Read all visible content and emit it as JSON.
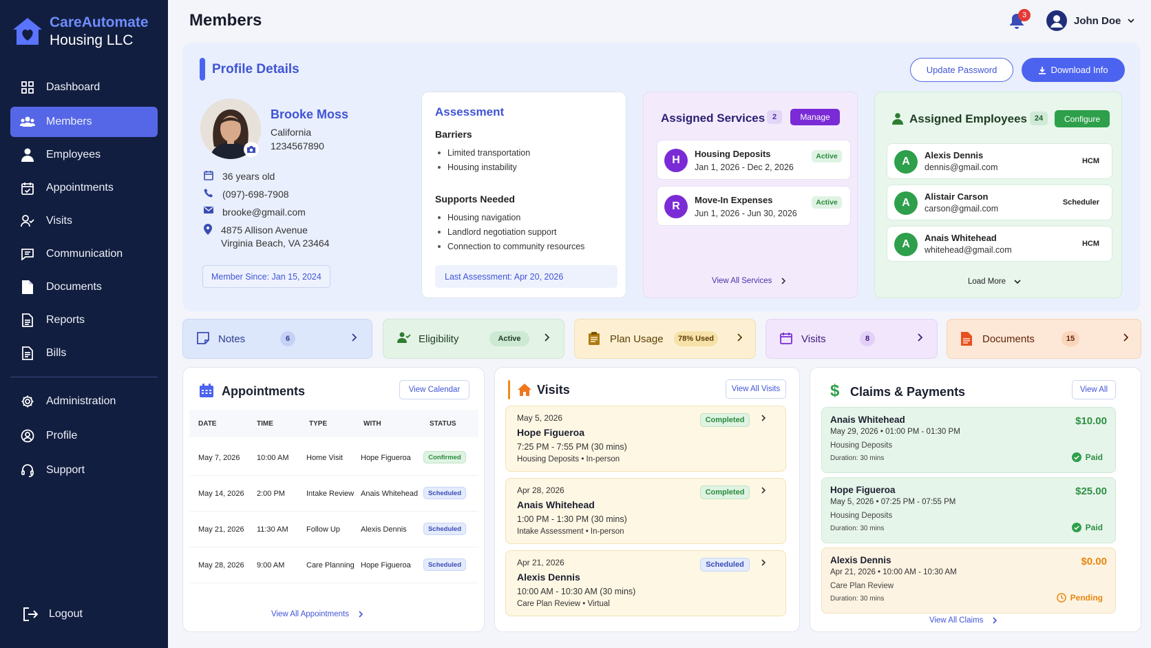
{
  "brand": {
    "line1": "CareAutomate",
    "line2": "Housing LLC"
  },
  "nav": {
    "items": [
      {
        "label": "Dashboard",
        "icon": "grid-icon"
      },
      {
        "label": "Members",
        "icon": "users-icon"
      },
      {
        "label": "Employees",
        "icon": "employee-icon"
      },
      {
        "label": "Appointments",
        "icon": "calendar-check-icon"
      },
      {
        "label": "Visits",
        "icon": "visit-icon"
      },
      {
        "label": "Communication",
        "icon": "chat-icon"
      },
      {
        "label": "Documents",
        "icon": "file-icon"
      },
      {
        "label": "Reports",
        "icon": "report-icon"
      },
      {
        "label": "Bills",
        "icon": "bill-icon"
      },
      {
        "label": "Administration",
        "icon": "gear-icon"
      },
      {
        "label": "Profile",
        "icon": "user-circle-icon"
      },
      {
        "label": "Support",
        "icon": "headset-icon"
      }
    ],
    "logout": "Logout"
  },
  "header": {
    "title": "Members",
    "notifications": "3",
    "user": "John Doe"
  },
  "profile": {
    "section_title": "Profile Details",
    "update_password": "Update Password",
    "download_info": "Download Info",
    "name": "Brooke Moss",
    "state": "California",
    "member_id": "1234567890",
    "age": "36 years old",
    "phone": "(097)-698-7908",
    "email": "brooke@gmail.com",
    "address1": "4875 Allison Avenue",
    "address2": "Virginia Beach, VA 23464",
    "member_since": "Member Since: Jan 15, 2024"
  },
  "assessment": {
    "title": "Assessment",
    "barriers_title": "Barriers",
    "barriers": [
      "Limited transportation",
      "Housing instability"
    ],
    "supports_title": "Supports Needed",
    "supports": [
      "Housing navigation",
      "Landlord negotiation support",
      "Connection to community resources"
    ],
    "last": "Last Assessment: Apr 20, 2026"
  },
  "services": {
    "title": "Assigned Services",
    "count": "2",
    "manage": "Manage",
    "items": [
      {
        "initial": "H",
        "name": "Housing Deposits",
        "dates": "Jan 1, 2026 - Dec 2, 2026",
        "status": "Active"
      },
      {
        "initial": "R",
        "name": "Move-In Expenses",
        "dates": "Jun 1, 2026 - Jun 30, 2026",
        "status": "Active"
      }
    ],
    "view_all": "View All Services"
  },
  "employees": {
    "title": "Assigned Employees",
    "count": "24",
    "configure": "Configure",
    "items": [
      {
        "initial": "A",
        "name": "Alexis Dennis",
        "email": "dennis@gmail.com",
        "role": "HCM"
      },
      {
        "initial": "A",
        "name": "Alistair Carson",
        "email": "carson@gmail.com",
        "role": "Scheduler"
      },
      {
        "initial": "A",
        "name": "Anais Whitehead",
        "email": "whitehead@gmail.com",
        "role": "HCM"
      }
    ],
    "load_more": "Load More"
  },
  "quick": {
    "notes": {
      "label": "Notes",
      "badge": "6"
    },
    "eligibility": {
      "label": "Eligibility",
      "badge": "Active"
    },
    "plan": {
      "label": "Plan Usage",
      "badge": "78% Used"
    },
    "visits": {
      "label": "Visits",
      "badge": "8"
    },
    "documents": {
      "label": "Documents",
      "badge": "15"
    }
  },
  "appointments": {
    "title": "Appointments",
    "view_calendar": "View Calendar",
    "headers": [
      "DATE",
      "TIME",
      "TYPE",
      "WITH",
      "STATUS"
    ],
    "rows": [
      {
        "date": "May 7, 2026",
        "time": "10:00 AM",
        "type": "Home Visit",
        "with": "Hope Figueroa",
        "status": "Confirmed"
      },
      {
        "date": "May 14, 2026",
        "time": "2:00 PM",
        "type": "Intake Review",
        "with": "Anais Whitehead",
        "status": "Scheduled"
      },
      {
        "date": "May 21, 2026",
        "time": "11:30 AM",
        "type": "Follow Up",
        "with": "Alexis Dennis",
        "status": "Scheduled"
      },
      {
        "date": "May 28, 2026",
        "time": "9:00 AM",
        "type": "Care Planning",
        "with": "Hope Figueroa",
        "status": "Scheduled"
      }
    ],
    "view_all": "View All Appointments"
  },
  "visits": {
    "title": "Visits",
    "view_all": "View All Visits",
    "items": [
      {
        "date": "May 5, 2026",
        "name": "Hope Figueroa",
        "time": "7:25 PM - 7:55 PM (30 mins)",
        "type": "Housing Deposits  •  In-person",
        "status": "Completed"
      },
      {
        "date": "Apr 28, 2026",
        "name": "Anais Whitehead",
        "time": "1:00 PM - 1:30 PM (30 mins)",
        "type": "Intake Assessment  •  In-person",
        "status": "Completed"
      },
      {
        "date": "Apr 21, 2026",
        "name": "Alexis Dennis",
        "time": "10:00 AM - 10:30 AM (30 mins)",
        "type": "Care Plan Review  •  Virtual",
        "status": "Scheduled"
      }
    ]
  },
  "claims": {
    "title": "Claims & Payments",
    "view_all_btn": "View All",
    "items": [
      {
        "name": "Anais Whitehead",
        "datetime": "May 29, 2026  •  01:00 PM - 01:30 PM",
        "service": "Housing Deposits",
        "duration": "Duration: 30 mins",
        "amount": "$10.00",
        "status": "Paid"
      },
      {
        "name": "Hope Figueroa",
        "datetime": "May 5, 2026  •  07:25 PM - 07:55 PM",
        "service": "Housing Deposits",
        "duration": "Duration: 30 mins",
        "amount": "$25.00",
        "status": "Paid"
      },
      {
        "name": "Alexis Dennis",
        "datetime": "Apr 21, 2026  •  10:00 AM - 10:30 AM",
        "service": "Care Plan Review",
        "duration": "Duration: 30 mins",
        "amount": "$0.00",
        "status": "Pending"
      }
    ],
    "view_all": "View All Claims"
  }
}
